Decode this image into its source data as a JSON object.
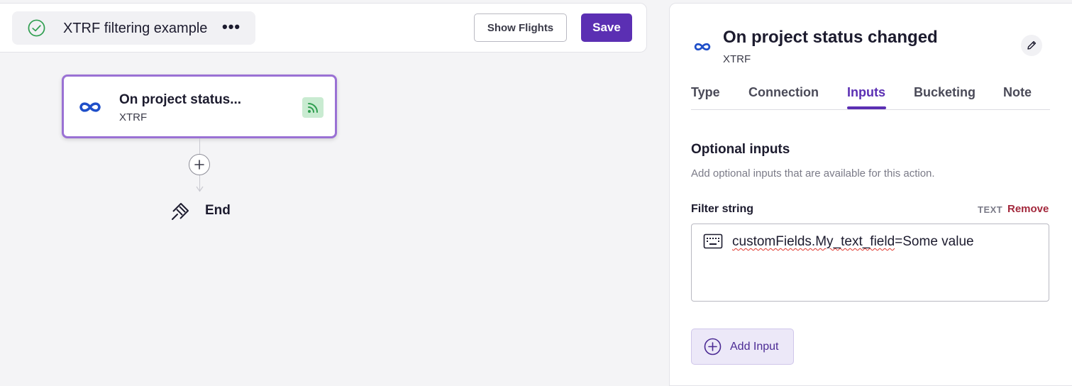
{
  "workflow": {
    "name": "XTRF filtering example",
    "more_label": "•••"
  },
  "toolbar": {
    "show_flights_label": "Show Flights",
    "save_label": "Save"
  },
  "flow": {
    "trigger": {
      "title": "On project status...",
      "app": "XTRF"
    },
    "end_label": "End"
  },
  "panel": {
    "title": "On project status changed",
    "app": "XTRF",
    "tabs": [
      {
        "label": "Type"
      },
      {
        "label": "Connection"
      },
      {
        "label": "Inputs",
        "active": true
      },
      {
        "label": "Bucketing"
      },
      {
        "label": "Note"
      }
    ],
    "section": {
      "title": "Optional inputs",
      "description": "Add optional inputs that are available for this action."
    },
    "field": {
      "label": "Filter string",
      "type": "TEXT",
      "remove_label": "Remove",
      "value_part1": "customFields.My_text_field",
      "value_part2": "=Some value"
    },
    "add_input_label": "Add Input"
  },
  "colors": {
    "accent": "#5b2fb3",
    "node_border": "#9a71d4",
    "success": "#2e9e4f",
    "remove": "#a3283c",
    "xtrf_logo": "#1f4fc9"
  },
  "icons": [
    "check-circle-icon",
    "more-icon",
    "xtrf-logo-icon",
    "rss-icon",
    "plus-icon",
    "end-flag-icon",
    "pencil-icon",
    "keyboard-icon",
    "plus-circle-icon"
  ]
}
